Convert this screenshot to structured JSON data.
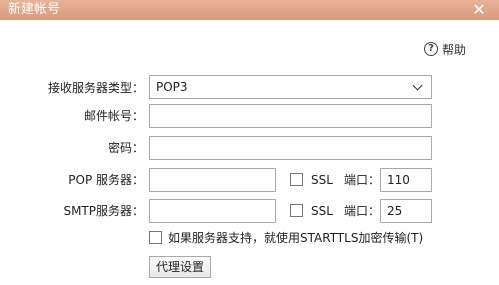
{
  "window": {
    "title": "新建帐号",
    "close_glyph": "✕"
  },
  "help": {
    "icon_glyph": "?",
    "label": "帮助"
  },
  "form": {
    "server_type_label": "接收服务器类型：",
    "server_type_value": "POP3",
    "account_label": "邮件帐号：",
    "account_value": "",
    "password_label": "密码：",
    "password_value": "",
    "pop_label": "POP 服务器：",
    "pop_value": "",
    "pop_ssl_label": "SSL",
    "pop_port_label": "端口：",
    "pop_port_value": "110",
    "smtp_label": "SMTP服务器：",
    "smtp_value": "",
    "smtp_ssl_label": "SSL",
    "smtp_port_label": "端口：",
    "smtp_port_value": "25",
    "starttls_label": "如果服务器支持，就使用STARTTLS加密传输(T)",
    "proxy_button": "代理设置"
  }
}
